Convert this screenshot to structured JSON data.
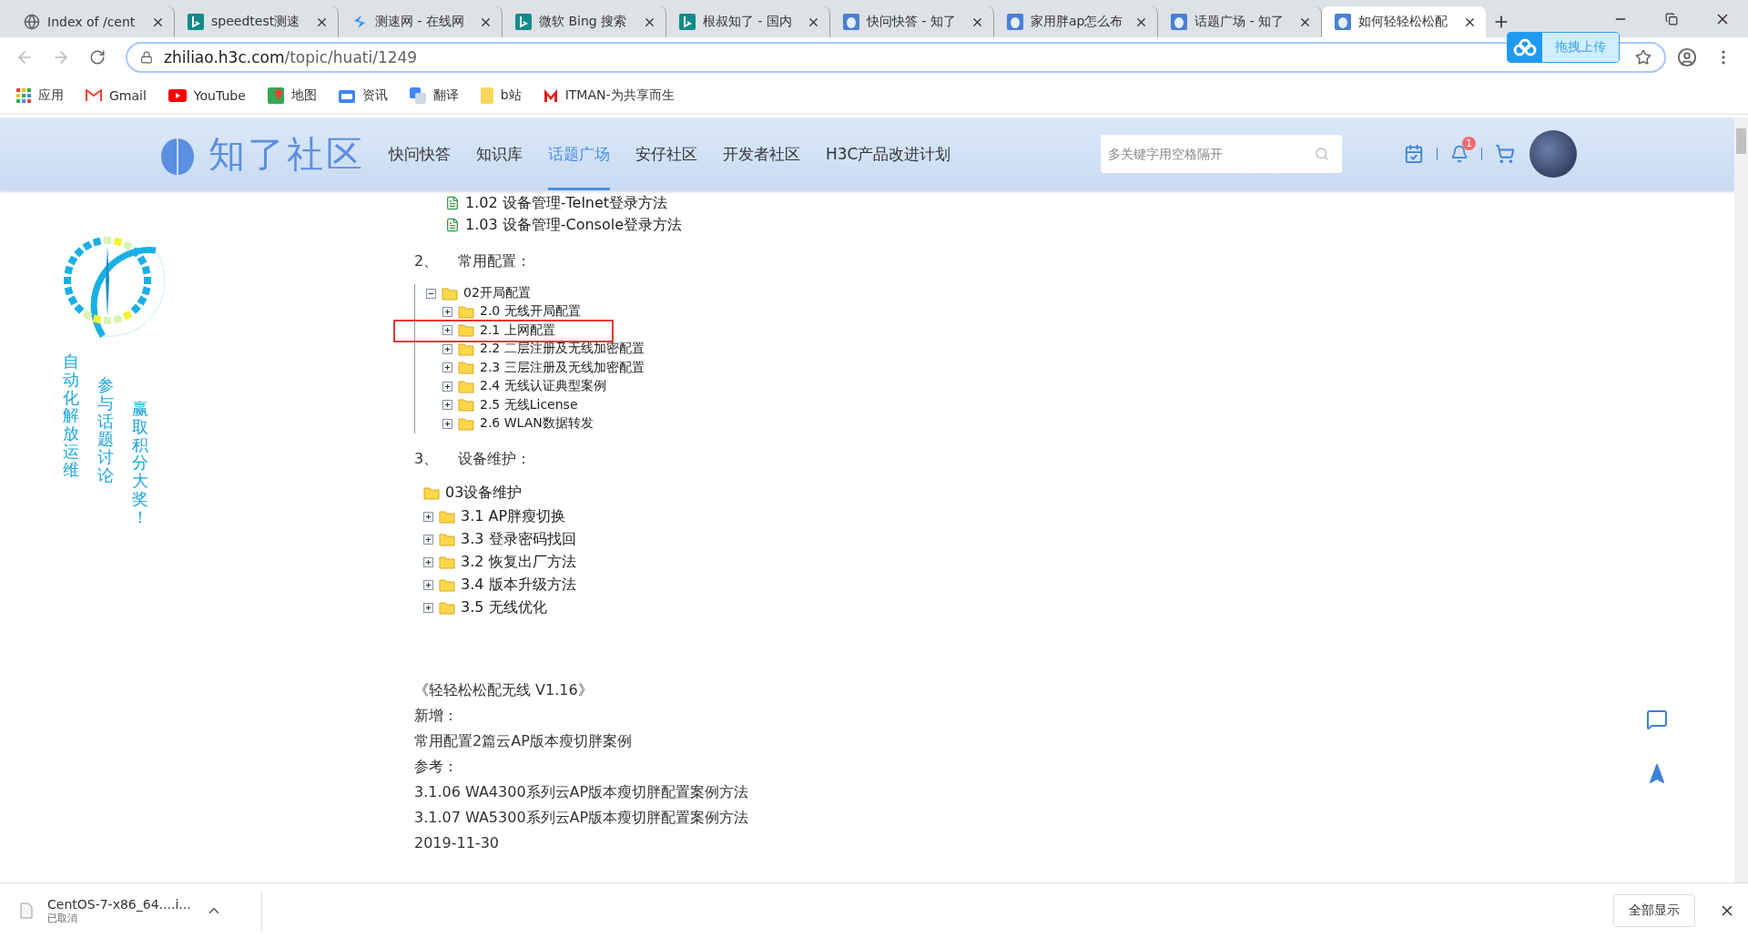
{
  "browser": {
    "tabs": [
      {
        "title": "Index of /cent",
        "selected": false
      },
      {
        "title": "speedtest测速",
        "selected": false
      },
      {
        "title": "测速网 - 在线网",
        "selected": false
      },
      {
        "title": "微软 Bing 搜索",
        "selected": false
      },
      {
        "title": "根叔知了 - 国内",
        "selected": false
      },
      {
        "title": "快问快答 - 知了",
        "selected": false
      },
      {
        "title": "家用胖ap怎么布",
        "selected": false
      },
      {
        "title": "话题广场 - 知了",
        "selected": false
      },
      {
        "title": "如何轻轻松松配",
        "selected": true
      }
    ],
    "address_host": "zhiliao.h3c.com",
    "address_path": "/topic/huati/1249",
    "upload_button": "拖拽上传",
    "bookmarks": [
      "应用",
      "Gmail",
      "YouTube",
      "地图",
      "资讯",
      "翻译",
      "b站",
      "ITMAN-为共享而生"
    ]
  },
  "site": {
    "logo": "知了社区",
    "nav": [
      {
        "label": "快问快答",
        "selected": false
      },
      {
        "label": "知识库",
        "selected": false
      },
      {
        "label": "话题广场",
        "selected": true
      },
      {
        "label": "安仔社区",
        "selected": false
      },
      {
        "label": "开发者社区",
        "selected": false
      },
      {
        "label": "H3C产品改进计划",
        "selected": false
      }
    ],
    "search": {
      "placeholder": "多关键字用空格隔开"
    },
    "notification_count": "1"
  },
  "banner": {
    "columns": [
      "自动化解放运维",
      "参与话题讨论",
      "赢取积分大奖！"
    ]
  },
  "article": {
    "top_items": [
      {
        "label": "1.02 设备管理-Telnet登录方法"
      },
      {
        "label": "1.03 设备管理-Console登录方法"
      }
    ],
    "sections": [
      {
        "number": "2、",
        "heading": "常用配置：",
        "tree": {
          "label": "02开局配置",
          "expanded": true,
          "children": [
            {
              "label": "2.0 无线开局配置",
              "expanded": false,
              "highlighted": false
            },
            {
              "label": "2.1 上网配置",
              "expanded": false,
              "highlighted": true
            },
            {
              "label": "2.2 二层注册及无线加密配置",
              "expanded": false,
              "highlighted": false
            },
            {
              "label": "2.3 三层注册及无线加密配置",
              "expanded": false,
              "highlighted": false
            },
            {
              "label": "2.4 无线认证典型案例",
              "expanded": false,
              "highlighted": false
            },
            {
              "label": "2.5 无线License",
              "expanded": false,
              "highlighted": false
            },
            {
              "label": "2.6 WLAN数据转发",
              "expanded": false,
              "highlighted": false
            }
          ]
        }
      },
      {
        "number": "3、",
        "heading": "设备维护：",
        "tree": {
          "label": "03设备维护",
          "children": [
            {
              "label": "3.1 AP胖瘦切换",
              "expanded": false,
              "highlighted": false
            },
            {
              "label": "3.3 登录密码找回",
              "expanded": false,
              "highlighted": false
            },
            {
              "label": "3.2 恢复出厂方法",
              "expanded": false,
              "highlighted": false
            },
            {
              "label": "3.4 版本升级方法",
              "expanded": false,
              "highlighted": false
            },
            {
              "label": "3.5 无线优化",
              "expanded": false,
              "highlighted": false
            }
          ]
        }
      }
    ],
    "notes": [
      "《轻轻松松配无线 V1.16》",
      "新增：",
      "常用配置2篇云AP版本瘦切胖案例",
      "参考：",
      "3.1.06 WA4300系列云AP版本瘦切胖配置案例方法",
      "3.1.07 WA5300系列云AP版本瘦切胖配置案例方法",
      "2019-11-30"
    ]
  },
  "downloads": {
    "file": "CentOS-7-x86_64....i...",
    "status": "已取消",
    "show_all": "全部显示"
  }
}
